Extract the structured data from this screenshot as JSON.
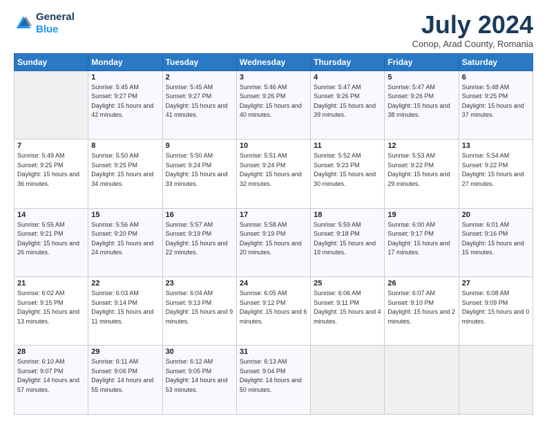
{
  "header": {
    "logo_line1": "General",
    "logo_line2": "Blue",
    "main_title": "July 2024",
    "subtitle": "Conop, Arad County, Romania"
  },
  "calendar": {
    "weekdays": [
      "Sunday",
      "Monday",
      "Tuesday",
      "Wednesday",
      "Thursday",
      "Friday",
      "Saturday"
    ],
    "weeks": [
      [
        {
          "day": "",
          "sunrise": "",
          "sunset": "",
          "daylight": ""
        },
        {
          "day": "1",
          "sunrise": "5:45 AM",
          "sunset": "9:27 PM",
          "daylight": "15 hours and 42 minutes."
        },
        {
          "day": "2",
          "sunrise": "5:45 AM",
          "sunset": "9:27 PM",
          "daylight": "15 hours and 41 minutes."
        },
        {
          "day": "3",
          "sunrise": "5:46 AM",
          "sunset": "9:26 PM",
          "daylight": "15 hours and 40 minutes."
        },
        {
          "day": "4",
          "sunrise": "5:47 AM",
          "sunset": "9:26 PM",
          "daylight": "15 hours and 39 minutes."
        },
        {
          "day": "5",
          "sunrise": "5:47 AM",
          "sunset": "9:26 PM",
          "daylight": "15 hours and 38 minutes."
        },
        {
          "day": "6",
          "sunrise": "5:48 AM",
          "sunset": "9:25 PM",
          "daylight": "15 hours and 37 minutes."
        }
      ],
      [
        {
          "day": "7",
          "sunrise": "5:49 AM",
          "sunset": "9:25 PM",
          "daylight": "15 hours and 36 minutes."
        },
        {
          "day": "8",
          "sunrise": "5:50 AM",
          "sunset": "9:25 PM",
          "daylight": "15 hours and 34 minutes."
        },
        {
          "day": "9",
          "sunrise": "5:50 AM",
          "sunset": "9:24 PM",
          "daylight": "15 hours and 33 minutes."
        },
        {
          "day": "10",
          "sunrise": "5:51 AM",
          "sunset": "9:24 PM",
          "daylight": "15 hours and 32 minutes."
        },
        {
          "day": "11",
          "sunrise": "5:52 AM",
          "sunset": "9:23 PM",
          "daylight": "15 hours and 30 minutes."
        },
        {
          "day": "12",
          "sunrise": "5:53 AM",
          "sunset": "9:22 PM",
          "daylight": "15 hours and 29 minutes."
        },
        {
          "day": "13",
          "sunrise": "5:54 AM",
          "sunset": "9:22 PM",
          "daylight": "15 hours and 27 minutes."
        }
      ],
      [
        {
          "day": "14",
          "sunrise": "5:55 AM",
          "sunset": "9:21 PM",
          "daylight": "15 hours and 26 minutes."
        },
        {
          "day": "15",
          "sunrise": "5:56 AM",
          "sunset": "9:20 PM",
          "daylight": "15 hours and 24 minutes."
        },
        {
          "day": "16",
          "sunrise": "5:57 AM",
          "sunset": "9:19 PM",
          "daylight": "15 hours and 22 minutes."
        },
        {
          "day": "17",
          "sunrise": "5:58 AM",
          "sunset": "9:19 PM",
          "daylight": "15 hours and 20 minutes."
        },
        {
          "day": "18",
          "sunrise": "5:59 AM",
          "sunset": "9:18 PM",
          "daylight": "15 hours and 19 minutes."
        },
        {
          "day": "19",
          "sunrise": "6:00 AM",
          "sunset": "9:17 PM",
          "daylight": "15 hours and 17 minutes."
        },
        {
          "day": "20",
          "sunrise": "6:01 AM",
          "sunset": "9:16 PM",
          "daylight": "15 hours and 15 minutes."
        }
      ],
      [
        {
          "day": "21",
          "sunrise": "6:02 AM",
          "sunset": "9:15 PM",
          "daylight": "15 hours and 13 minutes."
        },
        {
          "day": "22",
          "sunrise": "6:03 AM",
          "sunset": "9:14 PM",
          "daylight": "15 hours and 11 minutes."
        },
        {
          "day": "23",
          "sunrise": "6:04 AM",
          "sunset": "9:13 PM",
          "daylight": "15 hours and 9 minutes."
        },
        {
          "day": "24",
          "sunrise": "6:05 AM",
          "sunset": "9:12 PM",
          "daylight": "15 hours and 6 minutes."
        },
        {
          "day": "25",
          "sunrise": "6:06 AM",
          "sunset": "9:11 PM",
          "daylight": "15 hours and 4 minutes."
        },
        {
          "day": "26",
          "sunrise": "6:07 AM",
          "sunset": "9:10 PM",
          "daylight": "15 hours and 2 minutes."
        },
        {
          "day": "27",
          "sunrise": "6:08 AM",
          "sunset": "9:09 PM",
          "daylight": "15 hours and 0 minutes."
        }
      ],
      [
        {
          "day": "28",
          "sunrise": "6:10 AM",
          "sunset": "9:07 PM",
          "daylight": "14 hours and 57 minutes."
        },
        {
          "day": "29",
          "sunrise": "6:11 AM",
          "sunset": "9:06 PM",
          "daylight": "14 hours and 55 minutes."
        },
        {
          "day": "30",
          "sunrise": "6:12 AM",
          "sunset": "9:05 PM",
          "daylight": "14 hours and 53 minutes."
        },
        {
          "day": "31",
          "sunrise": "6:13 AM",
          "sunset": "9:04 PM",
          "daylight": "14 hours and 50 minutes."
        },
        {
          "day": "",
          "sunrise": "",
          "sunset": "",
          "daylight": ""
        },
        {
          "day": "",
          "sunrise": "",
          "sunset": "",
          "daylight": ""
        },
        {
          "day": "",
          "sunrise": "",
          "sunset": "",
          "daylight": ""
        }
      ]
    ]
  }
}
